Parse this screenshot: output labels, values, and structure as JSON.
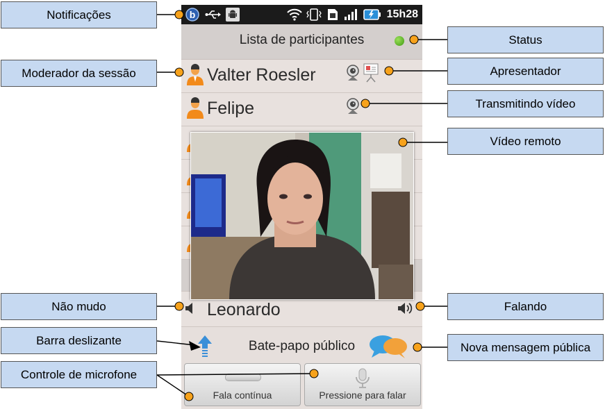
{
  "phone": {
    "status_bar": {
      "time": "15h28",
      "icons": [
        "b-app-icon",
        "usb-icon",
        "android-icon",
        "wifi-icon",
        "vibrate-icon",
        "sim-icon",
        "signal-icon",
        "battery-icon"
      ]
    },
    "header": {
      "title": "Lista de participantes",
      "status_color": "#3f9a12"
    },
    "participants": [
      {
        "name": "Valter Roesler",
        "icons": [
          "person-icon",
          "webcam-icon",
          "presentation-icon"
        ]
      },
      {
        "name": "Felipe",
        "icons": [
          "person-icon",
          "webcam-icon"
        ]
      },
      {
        "name": "Leonardo",
        "icons": [
          "speaker-icon",
          "speaker-sound-icon"
        ]
      }
    ],
    "chat": {
      "label": "Bate-papo público",
      "icons": [
        "up-arrow-icon",
        "chat-bubbles-icon"
      ]
    },
    "mic_buttons": [
      {
        "label": "Fala contínua",
        "icon": "slider-handle-icon"
      },
      {
        "label": "Pressione para falar",
        "icon": "microphone-icon"
      }
    ]
  },
  "callouts": {
    "notificacoes": "Notificações",
    "moderador": "Moderador da sessão",
    "nao_mudo": "Não mudo",
    "barra_deslizante": "Barra deslizante",
    "controle_microfone": "Controle de microfone",
    "status": "Status",
    "apresentador": "Apresentador",
    "transmitindo_video": "Transmitindo vídeo",
    "video_remoto": "Vídeo remoto",
    "falando": "Falando",
    "nova_mensagem": "Nova mensagem pública"
  },
  "colors": {
    "callout_fill": "#c6d9f1",
    "callout_dot": "#f7a21b",
    "accent_orange": "#f28a1a",
    "bubble_blue": "#3aa0e0"
  }
}
